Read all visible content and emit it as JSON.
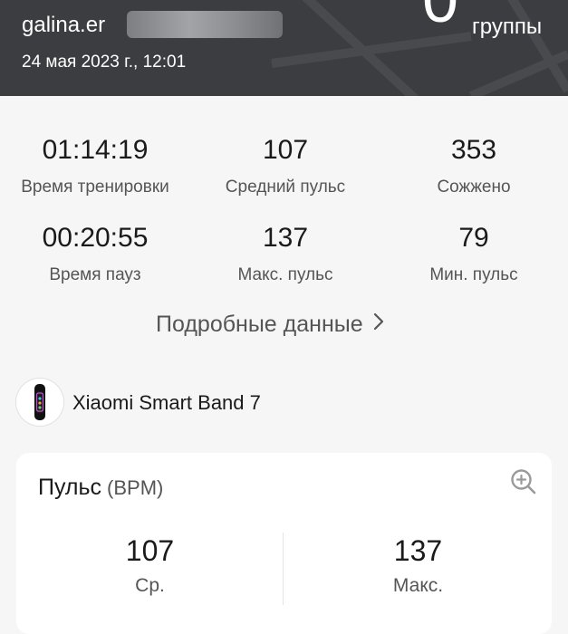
{
  "header": {
    "user_name": "galina.er",
    "datetime": "24 мая 2023 г., 12:01",
    "big_number": "0",
    "big_number_label": "группы"
  },
  "stats": [
    {
      "value": "01:14:19",
      "label": "Время тренировки"
    },
    {
      "value": "107",
      "label": "Средний пульс"
    },
    {
      "value": "353",
      "label": "Сожжено"
    },
    {
      "value": "00:20:55",
      "label": "Время пауз"
    },
    {
      "value": "137",
      "label": "Макс. пульс"
    },
    {
      "value": "79",
      "label": "Мин. пульс"
    }
  ],
  "details_link": "Подробные данные",
  "device": {
    "name": "Xiaomi Smart Band 7"
  },
  "pulse_card": {
    "title": "Пульс",
    "unit": "(BPM)",
    "avg_value": "107",
    "avg_label": "Ср.",
    "max_value": "137",
    "max_label": "Макс."
  }
}
